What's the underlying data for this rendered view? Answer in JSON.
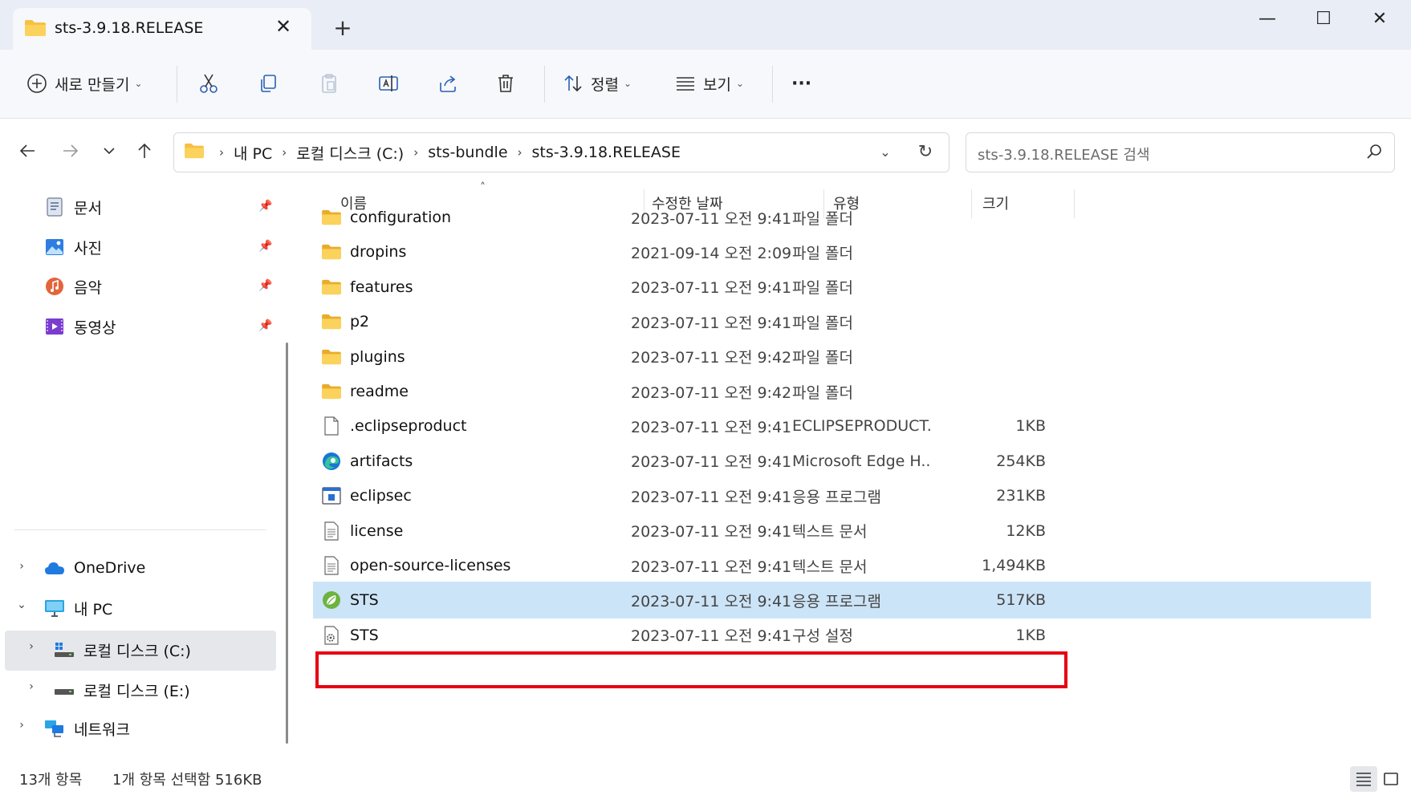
{
  "window": {
    "tab_title": "sts-3.9.18.RELEASE",
    "tab_close": "✕",
    "new_tab": "+",
    "minimize": "—",
    "maximize": "☐",
    "close": "✕"
  },
  "toolbar": {
    "new_label": "새로 만들기",
    "sort_label": "정렬",
    "view_label": "보기",
    "more_label": "···"
  },
  "address": {
    "crumbs": [
      "내 PC",
      "로컬 디스크 (C:)",
      "sts-bundle",
      "sts-3.9.18.RELEASE"
    ],
    "separator": "›",
    "search_placeholder": "sts-3.9.18.RELEASE 검색"
  },
  "sidebar": {
    "quick": [
      {
        "label": "문서",
        "icon": "documents-icon"
      },
      {
        "label": "사진",
        "icon": "pictures-icon"
      },
      {
        "label": "음악",
        "icon": "music-icon"
      },
      {
        "label": "동영상",
        "icon": "videos-icon"
      }
    ],
    "tree": [
      {
        "label": "OneDrive",
        "icon": "onedrive-icon",
        "expander": "›"
      },
      {
        "label": "내 PC",
        "icon": "this-pc-icon",
        "expander": "⌄"
      },
      {
        "label": "로컬 디스크 (C:)",
        "icon": "drive-c-icon",
        "expander": "›",
        "selected": true
      },
      {
        "label": "로컬 디스크 (E:)",
        "icon": "drive-e-icon",
        "expander": "›"
      },
      {
        "label": "네트워크",
        "icon": "network-icon",
        "expander": "›"
      }
    ]
  },
  "columns": {
    "name": "이름",
    "date": "수정한 날짜",
    "type": "유형",
    "size": "크기",
    "sort_indicator": "˄"
  },
  "files": [
    {
      "name": "configuration",
      "date": "2023-07-11 오전 9:41",
      "type": "파일 폴더",
      "size": "",
      "icon": "folder-icon"
    },
    {
      "name": "dropins",
      "date": "2021-09-14 오전 2:09",
      "type": "파일 폴더",
      "size": "",
      "icon": "folder-icon"
    },
    {
      "name": "features",
      "date": "2023-07-11 오전 9:41",
      "type": "파일 폴더",
      "size": "",
      "icon": "folder-icon"
    },
    {
      "name": "p2",
      "date": "2023-07-11 오전 9:41",
      "type": "파일 폴더",
      "size": "",
      "icon": "folder-icon"
    },
    {
      "name": "plugins",
      "date": "2023-07-11 오전 9:42",
      "type": "파일 폴더",
      "size": "",
      "icon": "folder-icon"
    },
    {
      "name": "readme",
      "date": "2023-07-11 오전 9:42",
      "type": "파일 폴더",
      "size": "",
      "icon": "folder-icon"
    },
    {
      "name": ".eclipseproduct",
      "date": "2023-07-11 오전 9:41",
      "type": "ECLIPSEPRODUCT...",
      "size": "1KB",
      "icon": "blank-file-icon"
    },
    {
      "name": "artifacts",
      "date": "2023-07-11 오전 9:41",
      "type": "Microsoft Edge H...",
      "size": "254KB",
      "icon": "edge-icon"
    },
    {
      "name": "eclipsec",
      "date": "2023-07-11 오전 9:41",
      "type": "응용 프로그램",
      "size": "231KB",
      "icon": "exe-icon"
    },
    {
      "name": "license",
      "date": "2023-07-11 오전 9:41",
      "type": "텍스트 문서",
      "size": "12KB",
      "icon": "text-file-icon"
    },
    {
      "name": "open-source-licenses",
      "date": "2023-07-11 오전 9:41",
      "type": "텍스트 문서",
      "size": "1,494KB",
      "icon": "text-file-icon"
    },
    {
      "name": "STS",
      "date": "2023-07-11 오전 9:41",
      "type": "응용 프로그램",
      "size": "517KB",
      "icon": "spring-icon",
      "selected": true
    },
    {
      "name": "STS",
      "date": "2023-07-11 오전 9:41",
      "type": "구성 설정",
      "size": "1KB",
      "icon": "config-file-icon"
    }
  ],
  "status": {
    "count": "13개 항목",
    "selection": "1개 항목 선택함 516KB"
  },
  "colors": {
    "selection": "#cce4f7",
    "highlight_border": "#e60012",
    "folder": "#f6c042"
  }
}
